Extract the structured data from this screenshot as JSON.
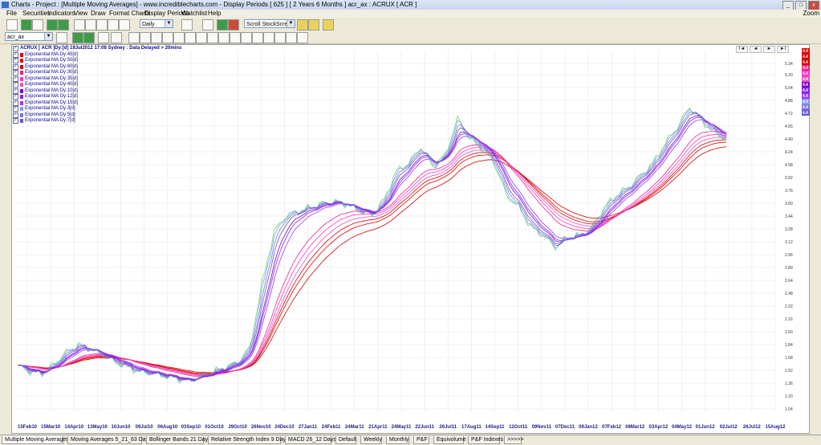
{
  "window": {
    "title": "Charts - Project : [Multiple Moving Averages] - www.incrediblecharts.com - Display Periods  [ 625 ]  [ 2 Years 6 Months ]  acr_ax : ACRUX  [ ACR ]",
    "zoom_label": "Zoom"
  },
  "menu": [
    "File",
    "Securities",
    "Indicators",
    "View",
    "Draw",
    "Format Charts",
    "Display Periods",
    "Watchlist",
    "Help"
  ],
  "toolbar": {
    "period_select": "Daily",
    "scroll_select": "Scroll StockScreen",
    "security_select": "acr_ax"
  },
  "legend": {
    "header": "ACRUX [ ACR ]Dy:[d]  19Jul2012 17:08 Sydney : Data Delayed > 20mins",
    "items": [
      {
        "label": "Exponential MA:Dy:45[d]",
        "color": "#e00000"
      },
      {
        "label": "Exponential MA:Dy:50[d]",
        "color": "#e00000"
      },
      {
        "label": "Exponential MA:Dy:60[d]",
        "color": "#d00000"
      },
      {
        "label": "Exponential MA:Dy:30[d]",
        "color": "#ee2288"
      },
      {
        "label": "Exponential MA:Dy:35[d]",
        "color": "#ff33cc"
      },
      {
        "label": "Exponential MA:Dy:40[d]",
        "color": "#e055c0"
      },
      {
        "label": "Exponential MA:Dy:10[d]",
        "color": "#7a00cc"
      },
      {
        "label": "Exponential MA:Dy:12[d]",
        "color": "#8822ee"
      },
      {
        "label": "Exponential MA:Dy:15[d]",
        "color": "#9933ff"
      },
      {
        "label": "Exponential MA:Dy:3[d]",
        "color": "#8899ee"
      },
      {
        "label": "Exponential MA:Dy:5[d]",
        "color": "#7777dd"
      },
      {
        "label": "Exponential MA:Dy:7[d]",
        "color": "#6655cc"
      }
    ]
  },
  "nav_buttons": [
    "I◄",
    "◄",
    "►",
    "►I"
  ],
  "chart_data": {
    "type": "line",
    "ylim": [
      1.0,
      5.5
    ],
    "yticks": [
      "5.34",
      "5.20",
      "5.04",
      "4.88",
      "4.72",
      "4.56",
      "4.40",
      "4.24",
      "4.08",
      "3.92",
      "3.76",
      "3.60",
      "3.44",
      "3.28",
      "3.12",
      "2.96",
      "2.80",
      "2.64",
      "2.48",
      "2.32",
      "2.16",
      "2.00",
      "1.84",
      "1.68",
      "1.52",
      "1.36",
      "1.20",
      "1.04"
    ],
    "x_labels": [
      "15Feb10",
      "15Mar10",
      "14Apr10",
      "13May10",
      "10Jun10",
      "09Jul10",
      "06Aug10",
      "03Sep10",
      "01Oct10",
      "29Oct10",
      "26Nov10",
      "24Dec10",
      "27Jan11",
      "24Feb11",
      "24Mar11",
      "21Apr11",
      "24May11",
      "22Jun11",
      "26Jul11",
      "17Aug11",
      "14Sep11",
      "12Oct11",
      "09Nov11",
      "07Dec11",
      "09Jan12",
      "07Feb12",
      "06Mar12",
      "03Apr12",
      "04May12",
      "01Jun12",
      "02Jul12",
      "26Jul12",
      "15Aug12"
    ],
    "price": [
      [
        0,
        1.58
      ],
      [
        1,
        1.5
      ],
      [
        2,
        1.48
      ],
      [
        3,
        1.6
      ],
      [
        4,
        1.75
      ],
      [
        5,
        1.84
      ],
      [
        6,
        1.78
      ],
      [
        7,
        1.7
      ],
      [
        8,
        1.62
      ],
      [
        9,
        1.56
      ],
      [
        10,
        1.5
      ],
      [
        11,
        1.48
      ],
      [
        12,
        1.45
      ],
      [
        13,
        1.42
      ],
      [
        14,
        1.38
      ],
      [
        15,
        1.45
      ],
      [
        16,
        1.5
      ],
      [
        17,
        1.56
      ],
      [
        18,
        1.62
      ],
      [
        19,
        1.8
      ],
      [
        20,
        2.6
      ],
      [
        21,
        3.25
      ],
      [
        22,
        3.45
      ],
      [
        23,
        3.5
      ],
      [
        24,
        3.55
      ],
      [
        25,
        3.6
      ],
      [
        26,
        3.62
      ],
      [
        27,
        3.58
      ],
      [
        28,
        3.5
      ],
      [
        29,
        3.45
      ],
      [
        30,
        3.65
      ],
      [
        31,
        4.0
      ],
      [
        32,
        4.1
      ],
      [
        33,
        4.3
      ],
      [
        34,
        4.05
      ],
      [
        35,
        4.2
      ],
      [
        36,
        4.65
      ],
      [
        37,
        4.4
      ],
      [
        38,
        4.28
      ],
      [
        39,
        4.1
      ],
      [
        40,
        3.7
      ],
      [
        41,
        3.55
      ],
      [
        42,
        3.3
      ],
      [
        43,
        3.2
      ],
      [
        44,
        3.05
      ],
      [
        45,
        3.18
      ],
      [
        46,
        3.2
      ],
      [
        47,
        3.3
      ],
      [
        48,
        3.55
      ],
      [
        49,
        3.7
      ],
      [
        50,
        3.8
      ],
      [
        51,
        3.95
      ],
      [
        52,
        4.1
      ],
      [
        53,
        4.35
      ],
      [
        54,
        4.55
      ],
      [
        55,
        4.8
      ],
      [
        56,
        4.62
      ],
      [
        57,
        4.48
      ],
      [
        58,
        4.4
      ]
    ],
    "ema_values": [
      [
        0,
        1.6
      ],
      [
        4,
        1.7
      ],
      [
        8,
        1.65
      ],
      [
        12,
        1.5
      ],
      [
        16,
        1.6
      ],
      [
        19,
        1.7
      ],
      [
        21,
        2.5
      ],
      [
        23,
        3.1
      ],
      [
        26,
        3.4
      ],
      [
        29,
        3.35
      ],
      [
        31,
        3.65
      ],
      [
        33,
        3.95
      ],
      [
        36,
        4.15
      ],
      [
        38,
        4.1
      ],
      [
        40,
        3.85
      ],
      [
        42,
        3.55
      ],
      [
        44,
        3.25
      ],
      [
        45,
        3.3
      ],
      [
        48,
        3.55
      ],
      [
        51,
        3.85
      ],
      [
        54,
        4.15
      ],
      [
        56,
        4.45
      ],
      [
        58,
        4.5
      ]
    ],
    "last_values": [
      "4.4",
      "4.4",
      "4.4",
      "4.4",
      "4.4",
      "4.4",
      "4.4",
      "4.4",
      "4.4",
      "4.4",
      "4.4",
      "4.4"
    ]
  },
  "bottom_tabs": [
    "Multiple Moving Averages",
    "Moving Averages 5_21_63 Days",
    "Bollinger Bands 21 Days",
    "Relative Strength Index 9 Days",
    "MACD 26_12 Days",
    "Default",
    "Weekly",
    "Monthly",
    "P&F",
    "Equivolume",
    "P&F Indexes",
    ">>>>>"
  ]
}
